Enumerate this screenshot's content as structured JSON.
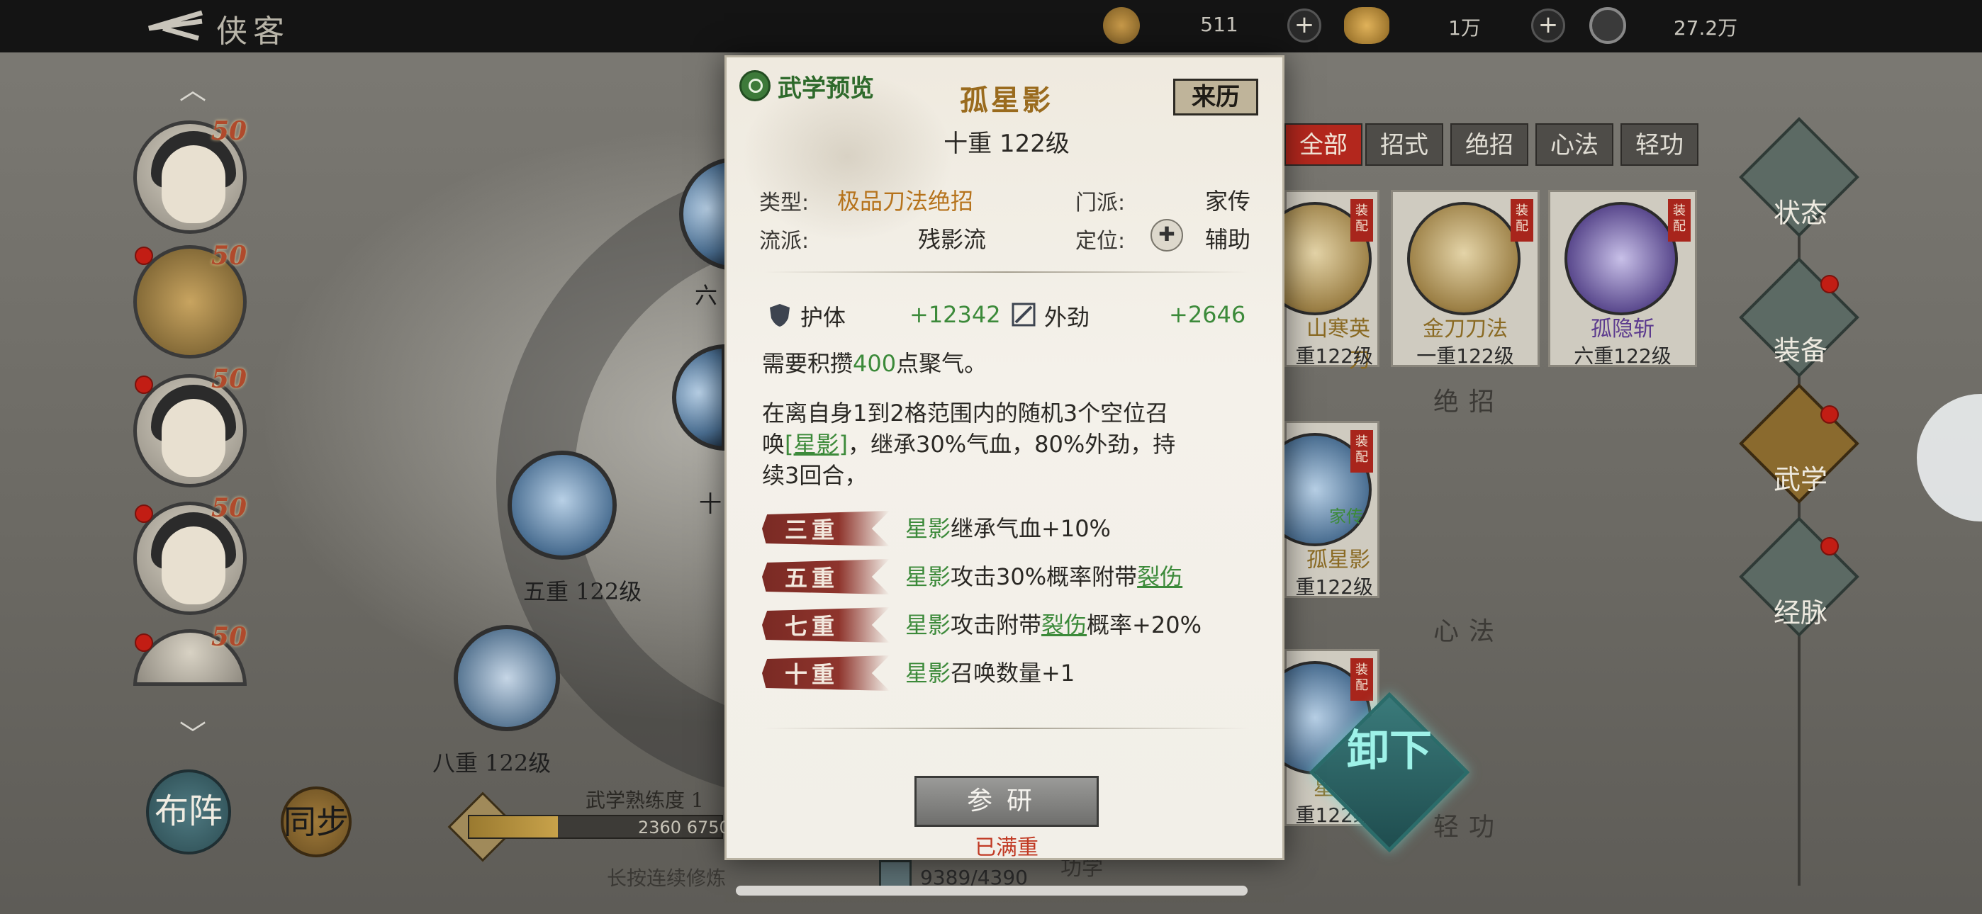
{
  "topbar": {
    "title": "侠客",
    "resources": [
      {
        "icon": "leaf-icon",
        "value": "511"
      },
      {
        "icon": "gold-ingot-icon",
        "value": "1万"
      },
      {
        "icon": "coin-icon",
        "value": "27.2万"
      }
    ]
  },
  "heroes": [
    {
      "level": "50"
    },
    {
      "level": "50"
    },
    {
      "level": "50"
    },
    {
      "level": "50"
    },
    {
      "level": "50"
    }
  ],
  "background_nodes": [
    {
      "label": "六"
    },
    {
      "label": "十"
    },
    {
      "label": "五重 122级"
    },
    {
      "label": "八重 122级"
    }
  ],
  "tabs": [
    "全部",
    "招式",
    "绝招",
    "心法",
    "轻功"
  ],
  "cards": [
    {
      "name": "山寒英刀",
      "level": "重122级",
      "tag": "装配"
    },
    {
      "name": "金刀刀法",
      "level": "一重122级",
      "tag": "装配"
    },
    {
      "name": "孤隐斩",
      "level": "六重122级",
      "tag": "装配"
    },
    {
      "name": "孤星影",
      "level": "重122级",
      "tag": "装配",
      "subtag": "家传"
    },
    {
      "name": "星",
      "level": "重122级",
      "tag": "装配"
    }
  ],
  "sections": {
    "ultimate": "绝招",
    "inner": "心法",
    "light": "轻功"
  },
  "side_nav": [
    {
      "label": "状态",
      "icon": "status-icon"
    },
    {
      "label": "装备",
      "icon": "equipment-icon"
    },
    {
      "label": "武学",
      "icon": "martial-arts-icon"
    },
    {
      "label": "经脉",
      "icon": "meridian-icon"
    }
  ],
  "modal": {
    "preview_label": "武学预览",
    "skill_name": "孤星影",
    "origin_button": "来历",
    "skill_level": "十重 122级",
    "type_key": "类型:",
    "type_value": "极品刀法绝招",
    "sect_key": "门派:",
    "sect_value": "家传",
    "school_key": "流派:",
    "school_value": "残影流",
    "role_key": "定位:",
    "role_value": "辅助",
    "stats": [
      {
        "icon": "shield-icon",
        "name": "护体",
        "value": "+12342"
      },
      {
        "icon": "blade-icon",
        "name": "外劲",
        "value": "+2646"
      }
    ],
    "requirement": {
      "pre": "需要积攒",
      "num": "400",
      "post": "点聚气。"
    },
    "description": {
      "line1": "在离自身1到2格范围内的随机3个空位召",
      "line2_pre": "唤",
      "line2_link": "[星影]",
      "line2_post": "，继承30%气血，80%外劲，持",
      "line3": "续3回合，"
    },
    "ranks": [
      {
        "rank": "三重",
        "hl": "星影",
        "text": "继承气血+10%"
      },
      {
        "rank": "五重",
        "hl": "星影",
        "text": "攻击30%概率附带",
        "link": "裂伤",
        "tail": ""
      },
      {
        "rank": "七重",
        "hl": "星影",
        "text": "攻击附带",
        "link": "裂伤",
        "tail": "概率+20%"
      },
      {
        "rank": "十重",
        "hl": "星影",
        "text": "召唤数量+1"
      }
    ],
    "study_button": "参研",
    "maxed_note": "已满重"
  },
  "bottom": {
    "formation_label": "布阵",
    "sync_label": "同步",
    "proficiency_label": "武学熟练度 1",
    "proficiency_value": "2360 6750",
    "proficiency_ratio": 0.35,
    "hold_hint": "长按连续修炼",
    "points_value": "9389/4390",
    "unequip_label": "卸下",
    "obscured_text": "功学"
  }
}
